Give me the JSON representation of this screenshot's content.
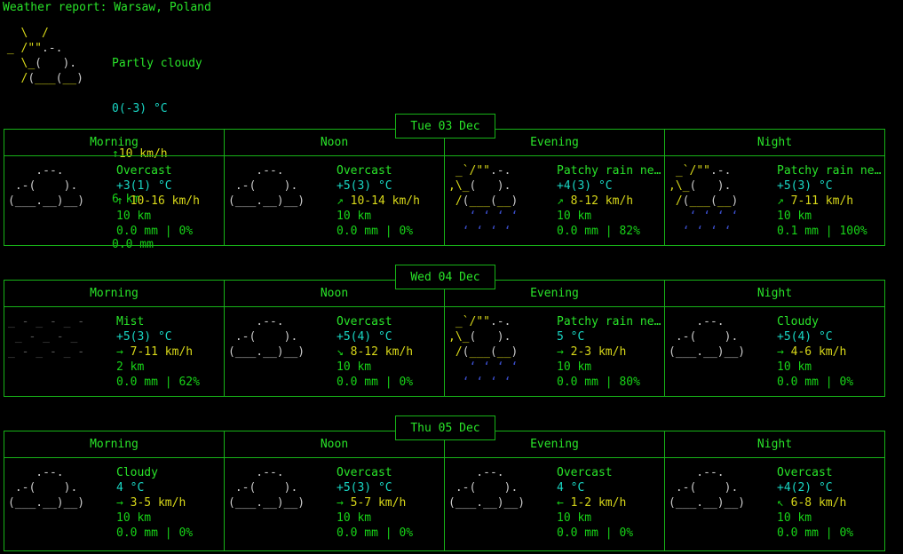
{
  "header": {
    "title": "Weather report: Warsaw, Poland"
  },
  "current": {
    "art": [
      "   \\  /",
      " _ /\"\".-.",
      "   \\_(   ).",
      "   /(___(__)"
    ],
    "condition": "Partly cloudy",
    "temperature": "0(-3) °C",
    "wind_arrow": "↑",
    "wind": "10 km/h",
    "visibility": "6 km",
    "precipitation": "0.0 mm"
  },
  "columns": [
    "Morning",
    "Noon",
    "Evening",
    "Night"
  ],
  "art_templates": {
    "cloud": [
      "    .--.",
      " .-(    ).",
      "(___.__)__)"
    ],
    "rain_sun": [
      " _`/\"\".-.",
      ",\\_(   ).",
      " /(___(__)",
      "   ‘ ‘ ‘ ‘",
      "  ‘ ‘ ‘ ‘"
    ],
    "mist": [
      "_ - _ - _ -",
      " _ - _ - _",
      "_ - _ - _ -"
    ]
  },
  "colors": {
    "green": "#18d318",
    "bright_green": "#29e329",
    "cyan": "#19d6c4",
    "yellow": "#d8d819",
    "white": "#c8c8c8",
    "blue": "#3c4fd0",
    "gray": "#585858",
    "border": "#17b317",
    "background": "#000000"
  },
  "days": [
    {
      "date": "Tue 03 Dec",
      "slots": [
        {
          "period": "Morning",
          "art": "cloud",
          "condition": "Overcast",
          "temperature": "+3(1) °C",
          "wind_arrow": "↑",
          "wind": "10-16 km/h",
          "visibility": "10 km",
          "precipitation": "0.0 mm | 0%"
        },
        {
          "period": "Noon",
          "art": "cloud",
          "condition": "Overcast",
          "temperature": "+5(3) °C",
          "wind_arrow": "↗",
          "wind": "10-14 km/h",
          "visibility": "10 km",
          "precipitation": "0.0 mm | 0%"
        },
        {
          "period": "Evening",
          "art": "rain_sun",
          "condition": "Patchy rain ne…",
          "temperature": "+4(3) °C",
          "wind_arrow": "↗",
          "wind": "8-12 km/h",
          "visibility": "10 km",
          "precipitation": "0.0 mm | 82%"
        },
        {
          "period": "Night",
          "art": "rain_sun",
          "condition": "Patchy rain ne…",
          "temperature": "+5(3) °C",
          "wind_arrow": "↗",
          "wind": "7-11 km/h",
          "visibility": "10 km",
          "precipitation": "0.1 mm | 100%"
        }
      ]
    },
    {
      "date": "Wed 04 Dec",
      "slots": [
        {
          "period": "Morning",
          "art": "mist",
          "condition": "Mist",
          "temperature": "+5(3) °C",
          "wind_arrow": "→",
          "wind": "7-11 km/h",
          "visibility": "2 km",
          "precipitation": "0.0 mm | 62%"
        },
        {
          "period": "Noon",
          "art": "cloud",
          "condition": "Overcast",
          "temperature": "+5(4) °C",
          "wind_arrow": "↘",
          "wind": "8-12 km/h",
          "visibility": "10 km",
          "precipitation": "0.0 mm | 0%"
        },
        {
          "period": "Evening",
          "art": "rain_sun",
          "condition": "Patchy rain ne…",
          "temperature": "5 °C",
          "wind_arrow": "→",
          "wind": "2-3 km/h",
          "visibility": "10 km",
          "precipitation": "0.0 mm | 80%"
        },
        {
          "period": "Night",
          "art": "cloud",
          "condition": "Cloudy",
          "temperature": "+5(4) °C",
          "wind_arrow": "→",
          "wind": "4-6 km/h",
          "visibility": "10 km",
          "precipitation": "0.0 mm | 0%"
        }
      ]
    },
    {
      "date": "Thu 05 Dec",
      "slots": [
        {
          "period": "Morning",
          "art": "cloud",
          "condition": "Cloudy",
          "temperature": "4 °C",
          "wind_arrow": "→",
          "wind": "3-5 km/h",
          "visibility": "10 km",
          "precipitation": "0.0 mm | 0%"
        },
        {
          "period": "Noon",
          "art": "cloud",
          "condition": "Overcast",
          "temperature": "+5(3) °C",
          "wind_arrow": "→",
          "wind": "5-7 km/h",
          "visibility": "10 km",
          "precipitation": "0.0 mm | 0%"
        },
        {
          "period": "Evening",
          "art": "cloud",
          "condition": "Overcast",
          "temperature": "4 °C",
          "wind_arrow": "←",
          "wind": "1-2 km/h",
          "visibility": "10 km",
          "precipitation": "0.0 mm | 0%"
        },
        {
          "period": "Night",
          "art": "cloud",
          "condition": "Overcast",
          "temperature": "+4(2) °C",
          "wind_arrow": "↖",
          "wind": "6-8 km/h",
          "visibility": "10 km",
          "precipitation": "0.0 mm | 0%"
        }
      ]
    }
  ]
}
